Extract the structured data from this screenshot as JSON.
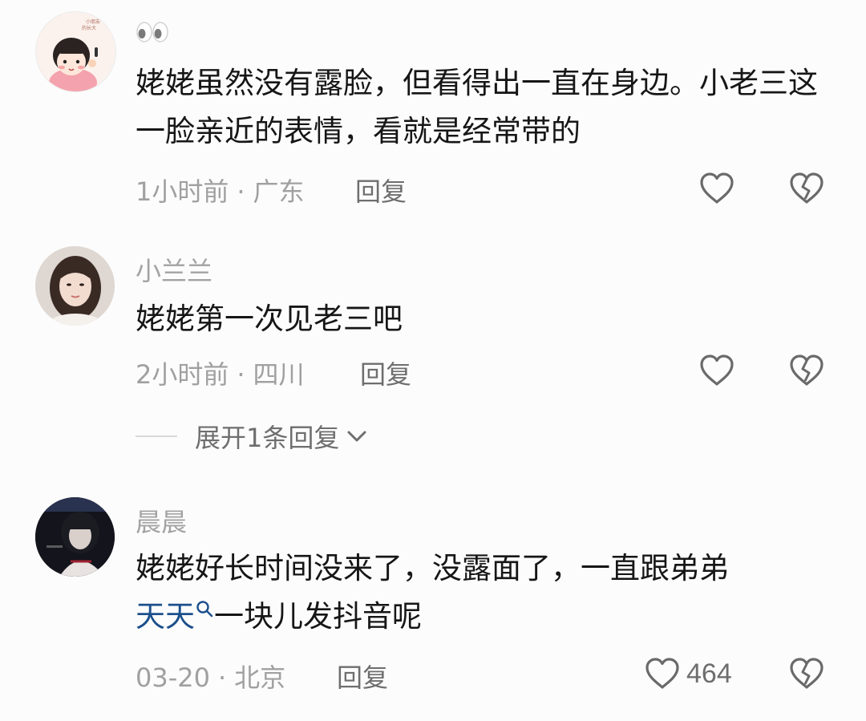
{
  "comments": [
    {
      "username": "",
      "username_emoji": "👀",
      "avatar_label": "小朋友一天天的长大",
      "text": "姥姥虽然没有露脸，但看得出一直在身边。小老三这一脸亲近的表情，看就是经常带的",
      "time": "1小时前",
      "location": "广东",
      "reply": "回复",
      "likes": ""
    },
    {
      "username": "小兰兰",
      "text": "姥姥第一次见老三吧",
      "time": "2小时前",
      "location": "四川",
      "reply": "回复",
      "likes": ""
    },
    {
      "username": "晨晨",
      "text_link": "天天",
      "text_rest": "一块儿发抖音呢",
      "text_before": "姥姥好长时间没来了，没露面了，一直跟弟弟",
      "time": "03-20",
      "location": "北京",
      "reply": "回复",
      "likes": "464"
    }
  ],
  "expand_replies": "展开1条回复",
  "separator": "·",
  "colors": {
    "link": "#1c4f8c",
    "meta": "#a0a0a0",
    "text": "#161616"
  },
  "icons": [
    "heart-outline-icon",
    "broken-heart-icon",
    "search-icon",
    "chevron-down-icon"
  ]
}
